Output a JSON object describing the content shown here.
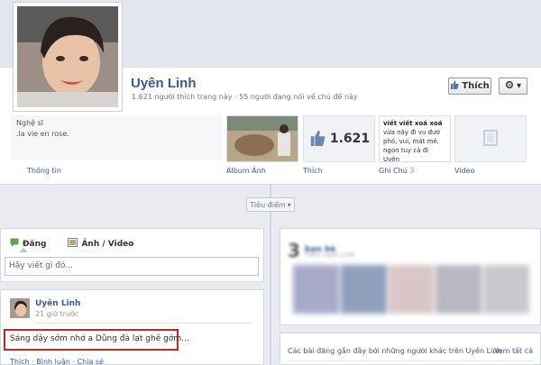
{
  "profile": {
    "name": "Uyên Linh",
    "stats": "1.621 người thích trang này · 55 người đang nói về chủ đề này",
    "like_button": "Thích",
    "gear_button": "▾"
  },
  "info": {
    "category": "Nghệ sĩ",
    "about": ".la vie en rose.",
    "link": "Thông tin"
  },
  "apps": {
    "album_label": "Album Ảnh",
    "likes_count": "1.621",
    "likes_label": "Thích",
    "notes_label": "Ghi Chú",
    "notes_count": "3",
    "notes_preview": [
      "viết viết xoá xoá",
      "vừa nãy đi vu đườ",
      "phố, vui, mát mẻ,",
      "ngon tuy cả đi Uyên"
    ],
    "video_label": "Video"
  },
  "timeline": {
    "focus_label": "Tiêu điểm"
  },
  "composer": {
    "tab_status": "Đăng",
    "tab_photo": "Ảnh / Video",
    "placeholder": "Hãy viết gì đó..."
  },
  "post": {
    "author": "Uyên Linh",
    "time": "21 giờ trước",
    "text": "Sáng dậy sớm nhớ a Dũng đà lạt ghê gớm...",
    "actions": "Thích · Bình luận · Chia sẻ"
  },
  "friends": {
    "count": "3",
    "title": "bạn bè",
    "subtitle": "Thích Uyên Linh"
  },
  "recent_posts": {
    "text": "Các bài đăng gần đây bởi những người khác trên Uyên Linh",
    "see_all": "Xem tất cả"
  }
}
